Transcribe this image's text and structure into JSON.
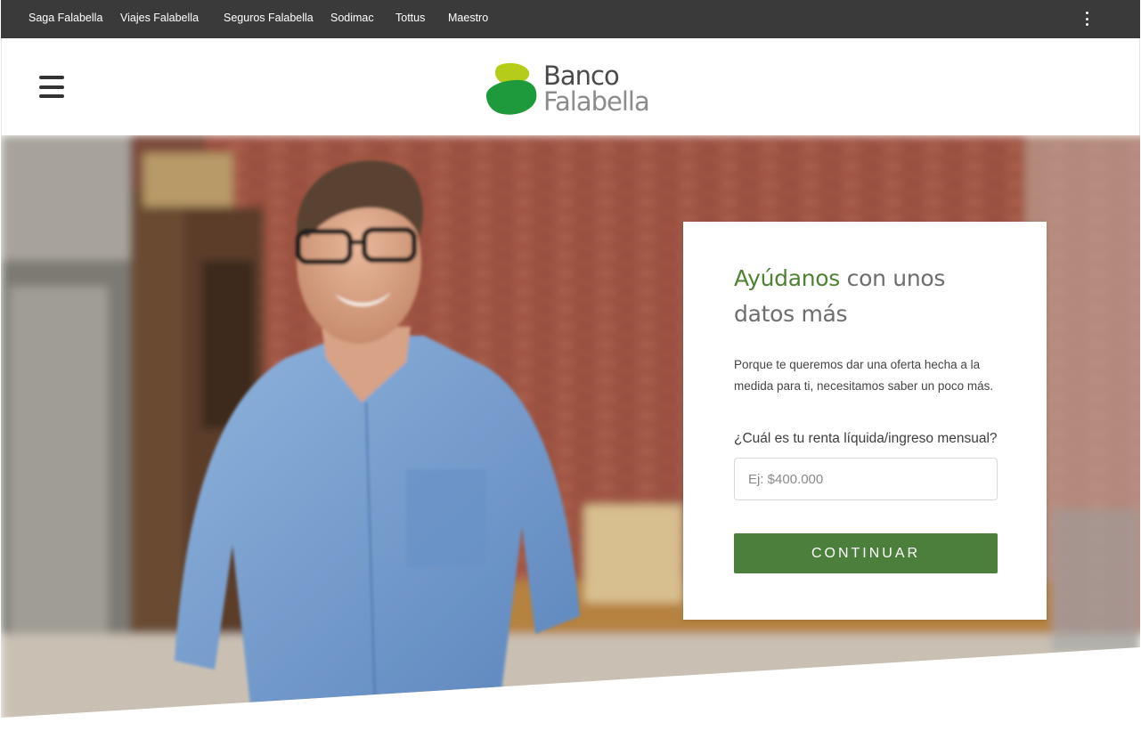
{
  "top_nav": {
    "links": [
      {
        "label": "Saga Falabella"
      },
      {
        "label": "Viajes Falabella"
      },
      {
        "label": "Seguros Falabella"
      },
      {
        "label": "Sodimac"
      },
      {
        "label": "Tottus"
      },
      {
        "label": "Maestro"
      }
    ],
    "more_icon": "kebab-vertical-icon"
  },
  "header": {
    "menu_icon": "hamburger-menu-icon",
    "logo": {
      "line1": "Banco",
      "line2": "Falabella"
    }
  },
  "form": {
    "title_accent": "Ayúdanos",
    "title_rest": " con unos datos más",
    "description": "Porque te queremos dar una oferta hecha a la medida para ti, necesitamos saber un poco más.",
    "question": "¿Cuál es tu renta líquida/ingreso mensual?",
    "income_input": {
      "value": "",
      "placeholder": "Ej: $400.000"
    },
    "submit_label": "CONTINUAR"
  },
  "colors": {
    "topbar": "#3a3a3a",
    "accent_green": "#4f8233",
    "button_green": "#4c7f3c",
    "logo_dark_green": "#1e9a3c",
    "logo_light_green": "#b5cc18"
  }
}
